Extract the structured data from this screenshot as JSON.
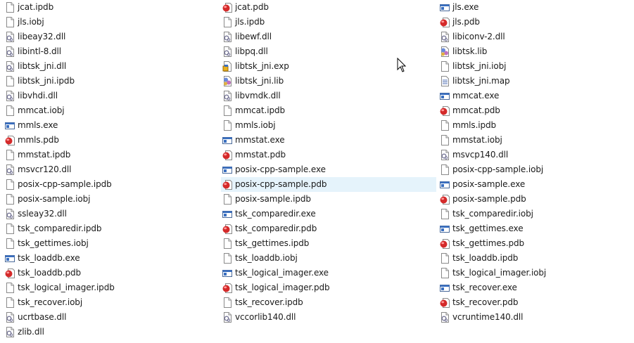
{
  "columns": [
    [
      {
        "name": "jcat.ipdb",
        "type": "file"
      },
      {
        "name": "jls.iobj",
        "type": "file"
      },
      {
        "name": "libeay32.dll",
        "type": "dll"
      },
      {
        "name": "libintl-8.dll",
        "type": "dll"
      },
      {
        "name": "libtsk_jni.dll",
        "type": "dll"
      },
      {
        "name": "libtsk_jni.ipdb",
        "type": "file"
      },
      {
        "name": "libvhdi.dll",
        "type": "dll"
      },
      {
        "name": "mmcat.iobj",
        "type": "file"
      },
      {
        "name": "mmls.exe",
        "type": "exe"
      },
      {
        "name": "mmls.pdb",
        "type": "pdb"
      },
      {
        "name": "mmstat.ipdb",
        "type": "file"
      },
      {
        "name": "msvcr120.dll",
        "type": "dll"
      },
      {
        "name": "posix-cpp-sample.ipdb",
        "type": "file"
      },
      {
        "name": "posix-sample.iobj",
        "type": "file"
      },
      {
        "name": "ssleay32.dll",
        "type": "dll"
      },
      {
        "name": "tsk_comparedir.ipdb",
        "type": "file"
      },
      {
        "name": "tsk_gettimes.iobj",
        "type": "file"
      },
      {
        "name": "tsk_loaddb.exe",
        "type": "exe"
      },
      {
        "name": "tsk_loaddb.pdb",
        "type": "pdb"
      },
      {
        "name": "tsk_logical_imager.ipdb",
        "type": "file"
      },
      {
        "name": "tsk_recover.iobj",
        "type": "file"
      },
      {
        "name": "ucrtbase.dll",
        "type": "dll"
      },
      {
        "name": "zlib.dll",
        "type": "dll"
      }
    ],
    [
      {
        "name": "jcat.pdb",
        "type": "pdb"
      },
      {
        "name": "jls.ipdb",
        "type": "file"
      },
      {
        "name": "libewf.dll",
        "type": "dll"
      },
      {
        "name": "libpq.dll",
        "type": "dll"
      },
      {
        "name": "libtsk_jni.exp",
        "type": "exp"
      },
      {
        "name": "libtsk_jni.lib",
        "type": "lib"
      },
      {
        "name": "libvmdk.dll",
        "type": "dll"
      },
      {
        "name": "mmcat.ipdb",
        "type": "file"
      },
      {
        "name": "mmls.iobj",
        "type": "file"
      },
      {
        "name": "mmstat.exe",
        "type": "exe"
      },
      {
        "name": "mmstat.pdb",
        "type": "pdb"
      },
      {
        "name": "posix-cpp-sample.exe",
        "type": "exe"
      },
      {
        "name": "posix-cpp-sample.pdb",
        "type": "pdb",
        "selected": true
      },
      {
        "name": "posix-sample.ipdb",
        "type": "file"
      },
      {
        "name": "tsk_comparedir.exe",
        "type": "exe"
      },
      {
        "name": "tsk_comparedir.pdb",
        "type": "pdb"
      },
      {
        "name": "tsk_gettimes.ipdb",
        "type": "file"
      },
      {
        "name": "tsk_loaddb.iobj",
        "type": "file"
      },
      {
        "name": "tsk_logical_imager.exe",
        "type": "exe"
      },
      {
        "name": "tsk_logical_imager.pdb",
        "type": "pdb"
      },
      {
        "name": "tsk_recover.ipdb",
        "type": "file"
      },
      {
        "name": "vccorlib140.dll",
        "type": "dll"
      }
    ],
    [
      {
        "name": "jls.exe",
        "type": "exe"
      },
      {
        "name": "jls.pdb",
        "type": "pdb"
      },
      {
        "name": "libiconv-2.dll",
        "type": "dll"
      },
      {
        "name": "libtsk.lib",
        "type": "lib"
      },
      {
        "name": "libtsk_jni.iobj",
        "type": "file"
      },
      {
        "name": "libtsk_jni.map",
        "type": "map"
      },
      {
        "name": "mmcat.exe",
        "type": "exe"
      },
      {
        "name": "mmcat.pdb",
        "type": "pdb"
      },
      {
        "name": "mmls.ipdb",
        "type": "file"
      },
      {
        "name": "mmstat.iobj",
        "type": "file"
      },
      {
        "name": "msvcp140.dll",
        "type": "dll"
      },
      {
        "name": "posix-cpp-sample.iobj",
        "type": "file"
      },
      {
        "name": "posix-sample.exe",
        "type": "exe"
      },
      {
        "name": "posix-sample.pdb",
        "type": "pdb"
      },
      {
        "name": "tsk_comparedir.iobj",
        "type": "file"
      },
      {
        "name": "tsk_gettimes.exe",
        "type": "exe"
      },
      {
        "name": "tsk_gettimes.pdb",
        "type": "pdb"
      },
      {
        "name": "tsk_loaddb.ipdb",
        "type": "file"
      },
      {
        "name": "tsk_logical_imager.iobj",
        "type": "file"
      },
      {
        "name": "tsk_recover.exe",
        "type": "exe"
      },
      {
        "name": "tsk_recover.pdb",
        "type": "pdb"
      },
      {
        "name": "vcruntime140.dll",
        "type": "dll"
      }
    ]
  ]
}
